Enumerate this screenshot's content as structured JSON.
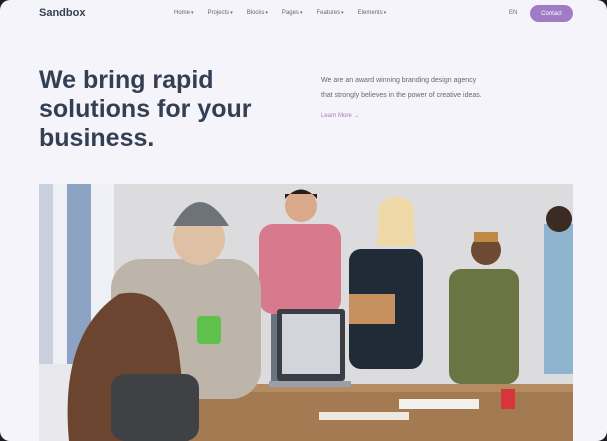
{
  "nav": {
    "logo": "Sandbox",
    "items": [
      {
        "label": "Home"
      },
      {
        "label": "Projects"
      },
      {
        "label": "Blocks"
      },
      {
        "label": "Pages"
      },
      {
        "label": "Features"
      },
      {
        "label": "Elements"
      }
    ],
    "language": "EN",
    "contact_button": "Contact",
    "accent_color": "#a07cc5"
  },
  "hero": {
    "headline_lines": [
      "We bring rapid",
      "solutions for your",
      "business."
    ],
    "description_lines": [
      "We are an award winning branding design agency",
      "that strongly believes in the power of creative ideas."
    ],
    "link_label": "Learn More"
  }
}
